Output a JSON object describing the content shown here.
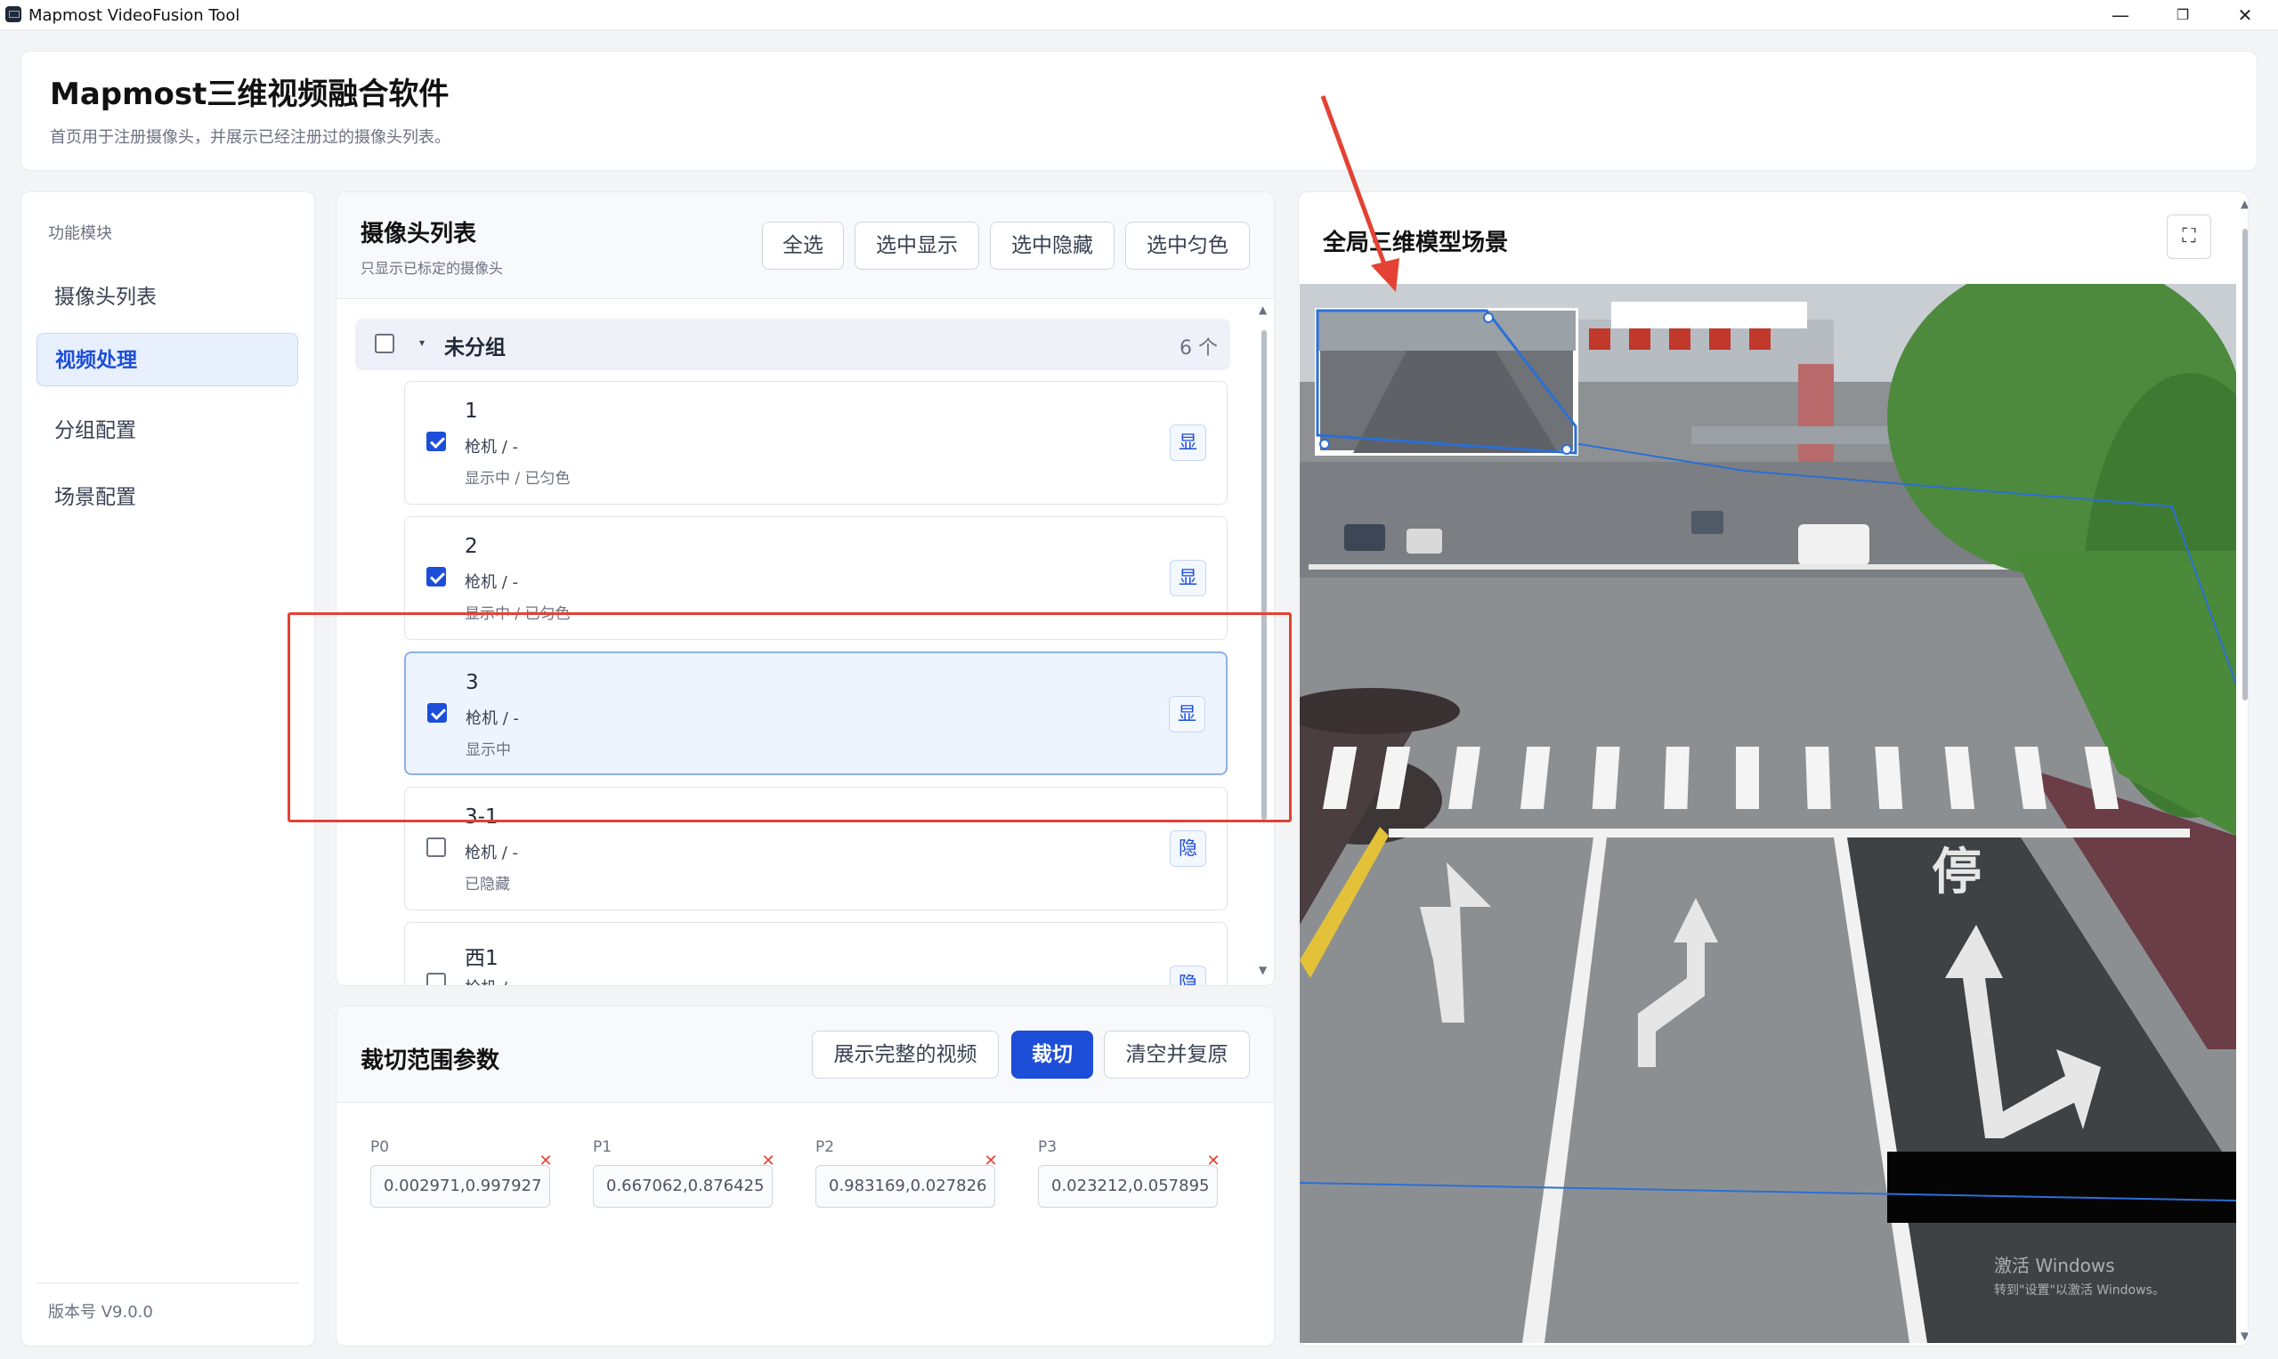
{
  "window": {
    "title": "Mapmost VideoFusion Tool",
    "controls": {
      "minimize": "—",
      "maximize": "❐",
      "close": "✕"
    }
  },
  "header": {
    "title": "Mapmost三维视频融合软件",
    "subtitle": "首页用于注册摄像头，并展示已经注册过的摄像头列表。"
  },
  "sidebar": {
    "heading": "功能模块",
    "items": [
      {
        "label": "摄像头列表",
        "active": false
      },
      {
        "label": "视频处理",
        "active": true
      },
      {
        "label": "分组配置",
        "active": false
      },
      {
        "label": "场景配置",
        "active": false
      }
    ],
    "version": "版本号 V9.0.0"
  },
  "camera_list": {
    "title": "摄像头列表",
    "subtitle": "只显示已标定的摄像头",
    "buttons": {
      "select_all": "全选",
      "show_selected": "选中显示",
      "hide_selected": "选中隐藏",
      "color_selected": "选中匀色"
    },
    "group": {
      "name": "未分组",
      "count": "6 个",
      "caret": "▾"
    },
    "cameras": [
      {
        "name": "1",
        "type": "枪机 / -",
        "status": "显示中 / 已匀色",
        "checked": true,
        "toggle": "显",
        "selected": false
      },
      {
        "name": "2",
        "type": "枪机 / -",
        "status": "显示中 / 已匀色",
        "checked": true,
        "toggle": "显",
        "selected": false
      },
      {
        "name": "3",
        "type": "枪机 / -",
        "status": "显示中",
        "checked": true,
        "toggle": "显",
        "selected": true
      },
      {
        "name": "3-1",
        "type": "枪机 / -",
        "status": "已隐藏",
        "checked": false,
        "toggle": "隐",
        "selected": false
      },
      {
        "name": "西1",
        "type": "枪机 / -",
        "status": "",
        "checked": false,
        "toggle": "隐",
        "selected": false
      }
    ]
  },
  "crop": {
    "title": "裁切范围参数",
    "buttons": {
      "show_full": "展示完整的视频",
      "crop": "裁切",
      "clear_restore": "清空并复原"
    },
    "points": [
      {
        "label": "P0",
        "value": "0.002971,0.997927"
      },
      {
        "label": "P1",
        "value": "0.667062,0.876425"
      },
      {
        "label": "P2",
        "value": "0.983169,0.027826"
      },
      {
        "label": "P3",
        "value": "0.023212,0.057895"
      }
    ],
    "clear_icon": "✕"
  },
  "scene": {
    "title": "全局三维模型场景",
    "fullscreen_icon": "⛶",
    "watermark_line1": "激活 Windows",
    "watermark_line2": "转到\"设置\"以激活 Windows。",
    "road_marking": "停"
  },
  "colors": {
    "accent": "#1d4ed8",
    "annotation": "#e34234"
  }
}
